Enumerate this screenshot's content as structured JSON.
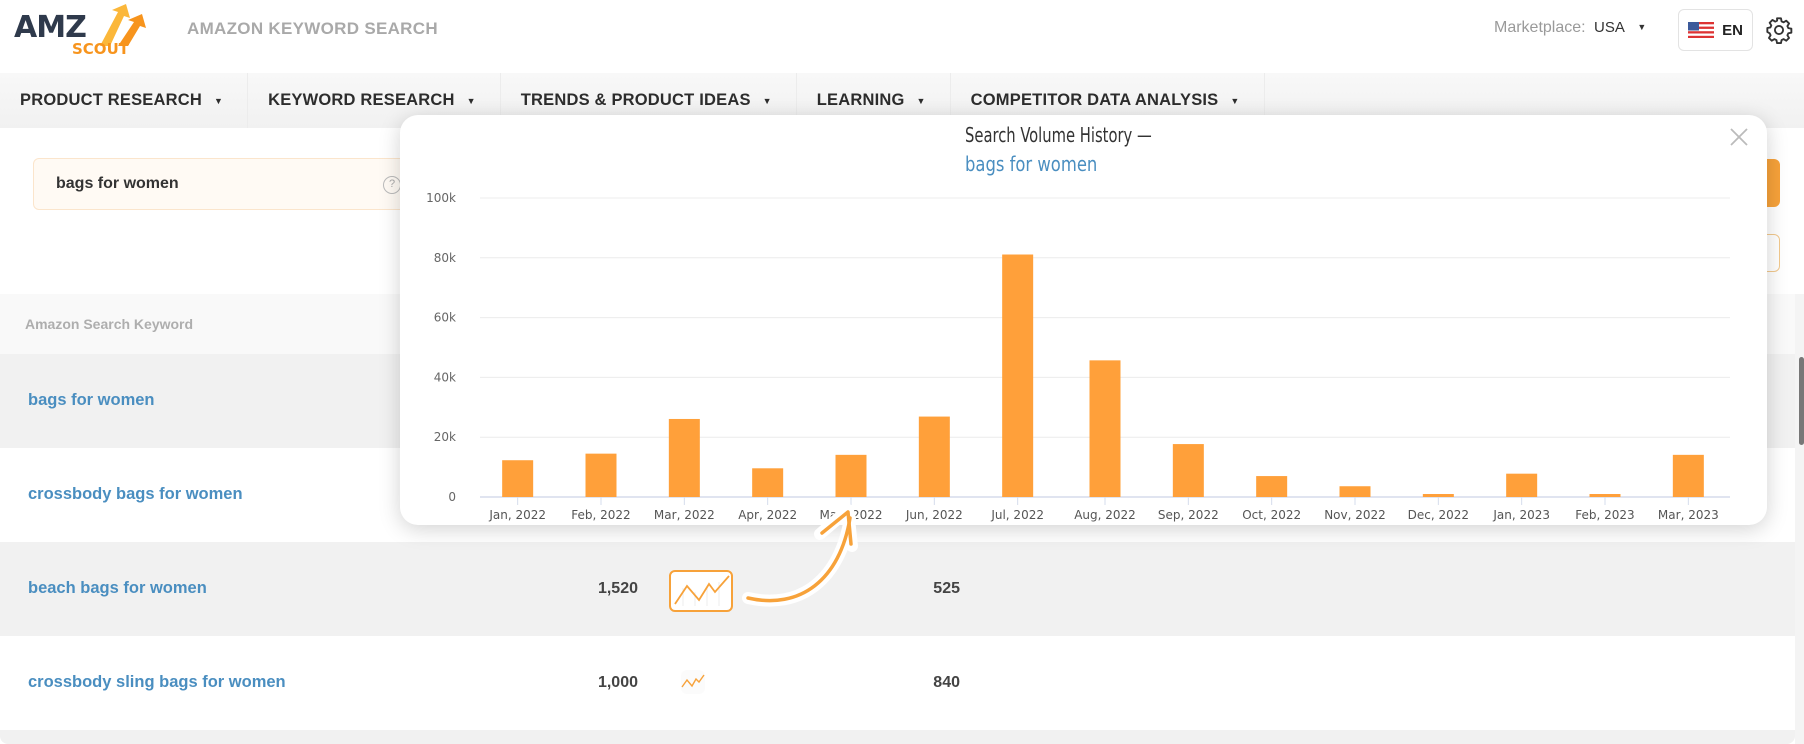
{
  "header": {
    "logo_top": "AMZ",
    "logo_bottom": "SCOUT",
    "app_title": "AMAZON KEYWORD SEARCH",
    "marketplace_label": "Marketplace:",
    "marketplace_value": "USA",
    "language": "EN",
    "icons": {
      "flag": "us-flag-icon",
      "settings": "gear-icon"
    }
  },
  "nav": {
    "items": [
      {
        "label": "PRODUCT RESEARCH"
      },
      {
        "label": "KEYWORD RESEARCH"
      },
      {
        "label": "TRENDS & PRODUCT IDEAS"
      },
      {
        "label": "LEARNING"
      },
      {
        "label": "COMPETITOR DATA ANALYSIS"
      }
    ]
  },
  "search": {
    "query": "bags for women",
    "help_symbol": "?"
  },
  "table": {
    "column_header": "Amazon Search Keyword",
    "rows": [
      {
        "keyword": "bags for women",
        "volume": "",
        "second_value": ""
      },
      {
        "keyword": "crossbody bags for women",
        "volume": "",
        "second_value": ""
      },
      {
        "keyword": "beach bags for women",
        "volume": "1,520",
        "second_value": "525",
        "trend_highlighted": true
      },
      {
        "keyword": "crossbody sling bags for women",
        "volume": "1,000",
        "second_value": "840"
      }
    ]
  },
  "modal": {
    "title": "Search Volume History —",
    "subtitle": "bags for women",
    "close_icon": "close-icon"
  },
  "colors": {
    "accent": "#f7a23a",
    "bar": "#ffa03a",
    "link": "#4a8ec0",
    "text_dark": "#2d2d2d"
  },
  "chart_data": {
    "type": "bar",
    "title": "Search Volume History — bags for women",
    "xlabel": "",
    "ylabel": "",
    "ylim": [
      0,
      100000
    ],
    "yticks": [
      0,
      20000,
      40000,
      60000,
      80000,
      100000
    ],
    "ytick_labels": [
      "0",
      "20k",
      "40k",
      "60k",
      "80k",
      "100k"
    ],
    "grid": true,
    "legend": "none",
    "categories": [
      "Jan, 2022",
      "Feb, 2022",
      "Mar, 2022",
      "Apr, 2022",
      "May, 2022",
      "Jun, 2022",
      "Jul, 2022",
      "Aug, 2022",
      "Sep, 2022",
      "Oct, 2022",
      "Nov, 2022",
      "Dec, 2022",
      "Jan, 2023",
      "Feb, 2023",
      "Mar, 2023"
    ],
    "values": [
      12300,
      14500,
      26100,
      9600,
      14100,
      26900,
      81100,
      45700,
      17700,
      7000,
      3600,
      1000,
      7800,
      1000,
      14100
    ]
  }
}
